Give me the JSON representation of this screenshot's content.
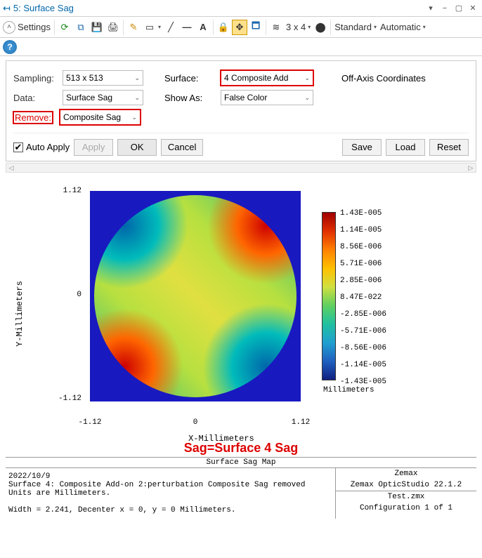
{
  "window": {
    "title": "5: Surface Sag",
    "controls": {
      "dropdown": "▾",
      "min": "−",
      "restore": "▢",
      "close": "✕"
    }
  },
  "toolbar": {
    "settings_label": "Settings",
    "grid_label": "3 x 4",
    "standard_label": "Standard",
    "automatic_label": "Automatic"
  },
  "settings": {
    "sampling_label": "Sampling:",
    "sampling_value": "513 x 513",
    "data_label": "Data:",
    "data_value": "Surface Sag",
    "remove_label": "Remove:",
    "remove_value": "Composite Sag",
    "surface_label": "Surface:",
    "surface_value": "4 Composite Add",
    "showas_label": "Show As:",
    "showas_value": "False Color",
    "offaxis_label": "Off-Axis Coordinates",
    "autoapply_label": "Auto Apply",
    "apply": "Apply",
    "ok": "OK",
    "cancel": "Cancel",
    "save": "Save",
    "load": "Load",
    "reset": "Reset"
  },
  "chart_data": {
    "type": "heatmap",
    "title": "",
    "xlabel": "X-Millimeters",
    "ylabel": "Y-Millimeters",
    "xlim": [
      -1.12,
      1.12
    ],
    "ylim": [
      -1.12,
      1.12
    ],
    "xticks": [
      -1.12,
      0,
      1.12
    ],
    "yticks": [
      -1.12,
      0,
      1.12
    ],
    "colorbar_unit": "Millimeters",
    "colorbar_ticks": [
      "1.43E-005",
      "1.14E-005",
      "8.56E-006",
      "5.71E-006",
      "2.85E-006",
      "8.47E-022",
      "-2.85E-006",
      "-5.71E-006",
      "-8.56E-006",
      "-1.14E-005",
      "-1.43E-005"
    ]
  },
  "annot": {
    "equation": "Sag=Surface 4 Sag"
  },
  "footer": {
    "title": "Surface Sag Map",
    "left": "2022/10/9\nSurface 4: Composite Add-on 2:perturbation Composite Sag removed\nUnits are Millimeters.\n\nWidth = 2.241, Decenter x = 0, y = 0 Millimeters.",
    "vendor": "Zemax",
    "product": "Zemax OpticStudio 22.1.2",
    "file": "Test.zmx",
    "config": "Configuration 1 of 1"
  }
}
